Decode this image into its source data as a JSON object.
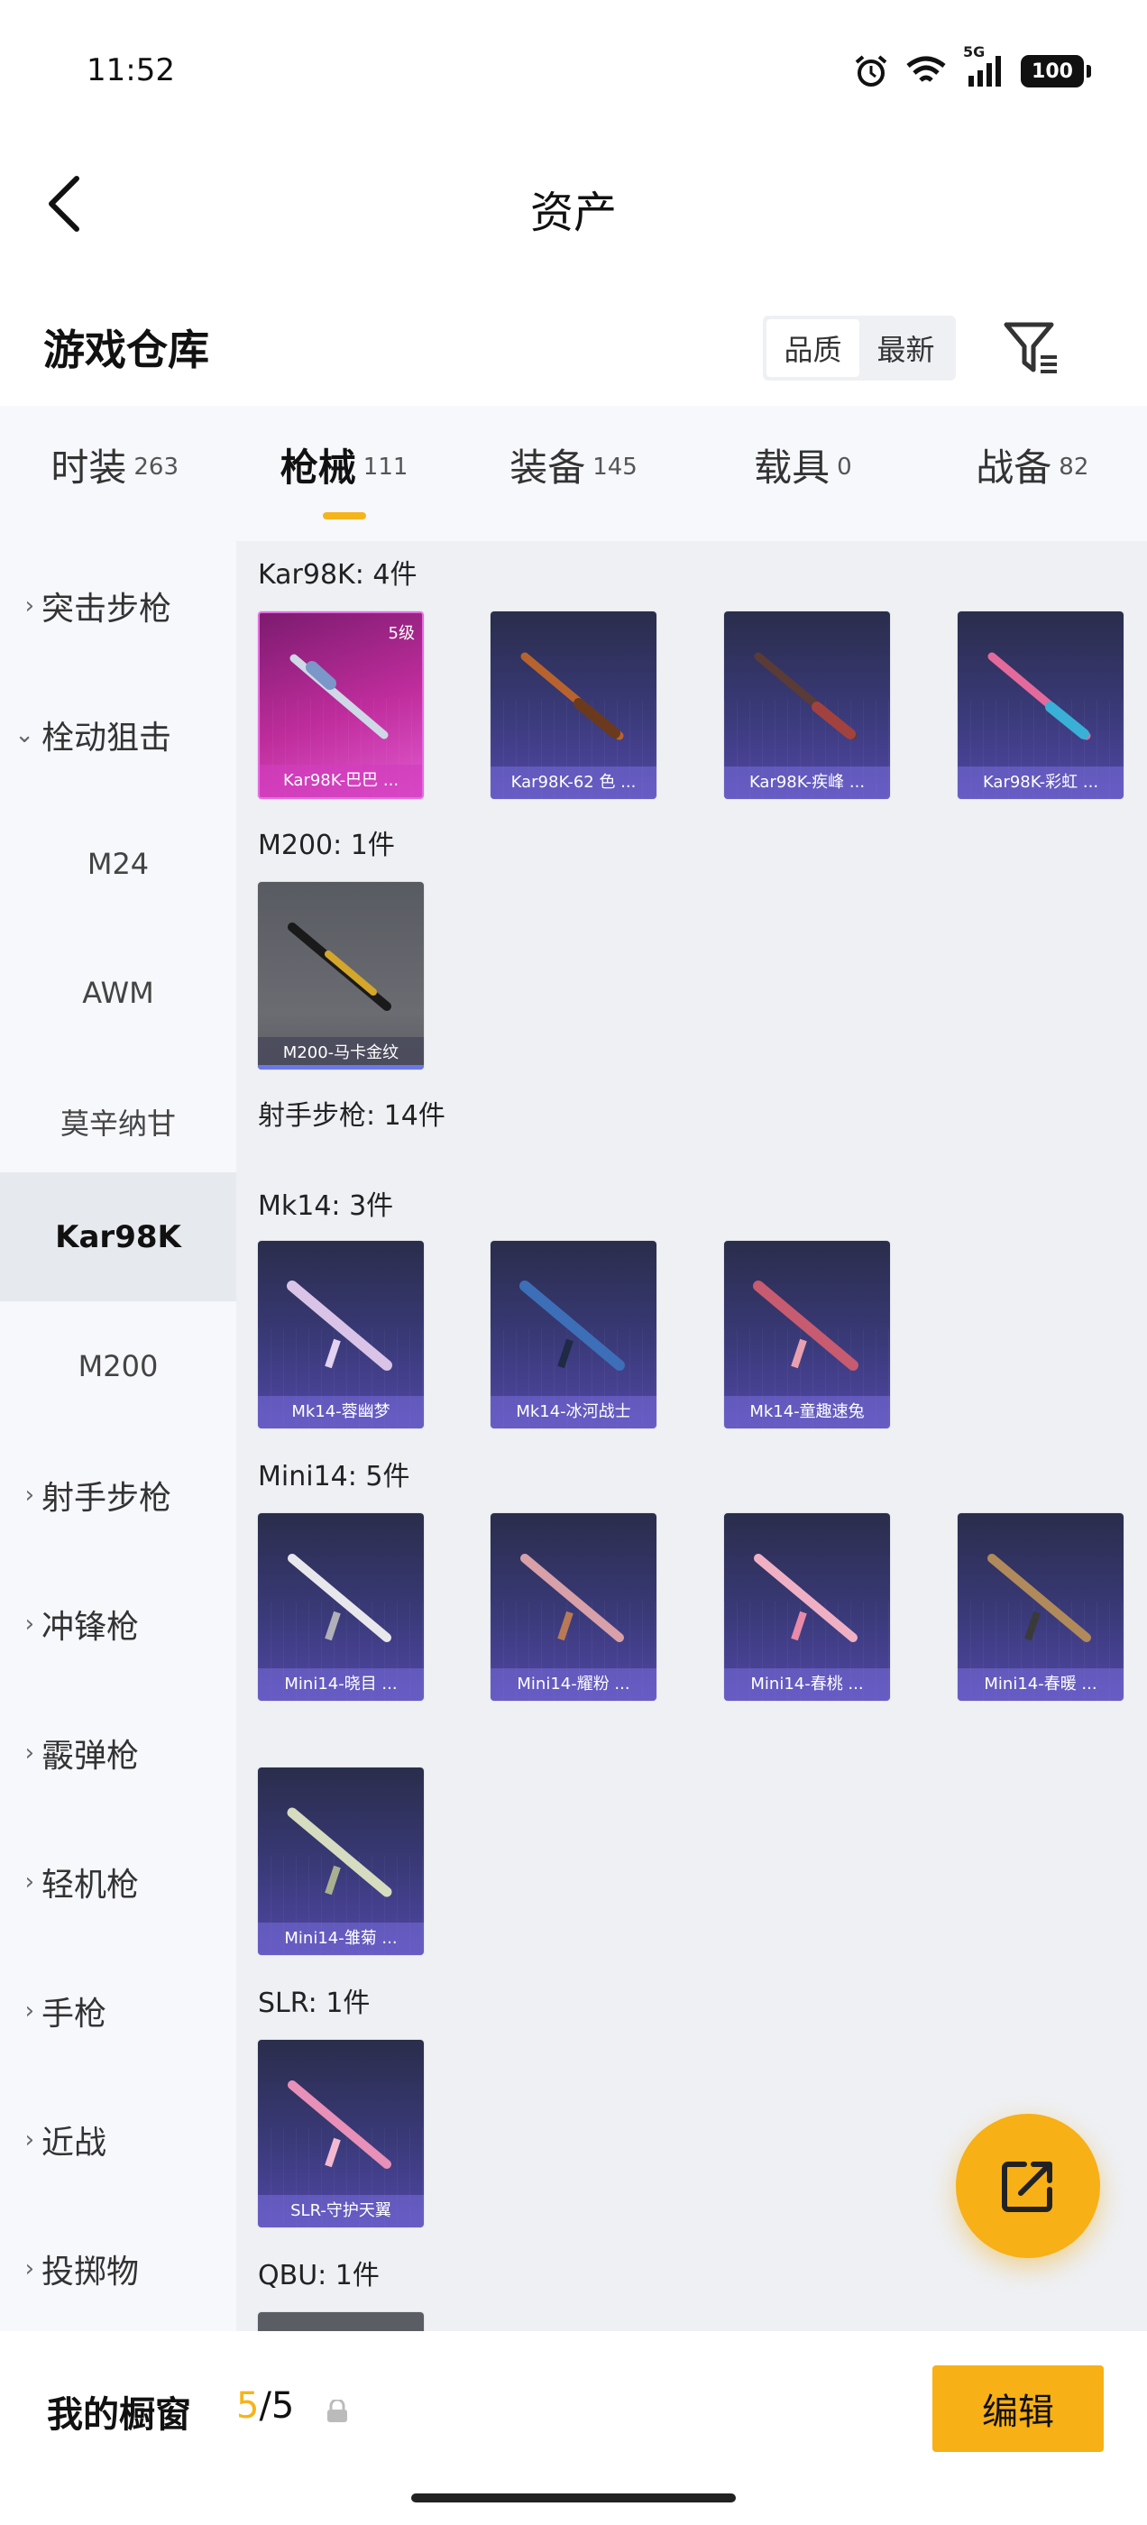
{
  "status_bar": {
    "time": "11:52",
    "network": "5G",
    "battery": "100"
  },
  "header": {
    "title": "资产"
  },
  "warehouse": {
    "title": "游戏仓库",
    "sort_options": [
      "品质",
      "最新"
    ]
  },
  "tabs": [
    {
      "label": "时装",
      "count": "263"
    },
    {
      "label": "枪械",
      "count": "111"
    },
    {
      "label": "装备",
      "count": "145"
    },
    {
      "label": "载具",
      "count": "0"
    },
    {
      "label": "战备",
      "count": "82"
    }
  ],
  "sidebar": {
    "items": [
      {
        "label": "突击步枪",
        "chevron": "›"
      },
      {
        "label": "栓动狙击",
        "chevron": "⌄"
      },
      {
        "label": "M24"
      },
      {
        "label": "AWM"
      },
      {
        "label": "莫辛纳甘"
      },
      {
        "label": "Kar98K"
      },
      {
        "label": "M200"
      },
      {
        "label": "射手步枪",
        "chevron": "›"
      },
      {
        "label": "冲锋枪",
        "chevron": "›"
      },
      {
        "label": "霰弹枪",
        "chevron": "›"
      },
      {
        "label": "轻机枪",
        "chevron": "›"
      },
      {
        "label": "手枪",
        "chevron": "›"
      },
      {
        "label": "近战",
        "chevron": "›"
      },
      {
        "label": "投掷物",
        "chevron": "›"
      }
    ]
  },
  "content": {
    "groups": [
      {
        "title": "Kar98K: 4件"
      },
      {
        "title": "M200: 1件"
      },
      {
        "title": "射手步枪: 14件"
      },
      {
        "title": "Mk14: 3件"
      },
      {
        "title": "Mini14: 5件"
      },
      {
        "title": "SLR: 1件"
      },
      {
        "title": "QBU: 1件"
      }
    ],
    "cards": [
      {
        "label": "Kar98K-巴巴 ...",
        "badge": "5级"
      },
      {
        "label": "Kar98K-62 色 ..."
      },
      {
        "label": "Kar98K-疾峰 ..."
      },
      {
        "label": "Kar98K-彩虹 ..."
      },
      {
        "label": "M200-马卡金纹"
      },
      {
        "label": "Mk14-蓉幽梦"
      },
      {
        "label": "Mk14-冰河战士"
      },
      {
        "label": "Mk14-童趣速兔"
      },
      {
        "label": "Mini14-晓目 ..."
      },
      {
        "label": "Mini14-耀粉 ..."
      },
      {
        "label": "Mini14-春桃 ..."
      },
      {
        "label": "Mini14-春暖 ..."
      },
      {
        "label": "Mini14-雏菊 ..."
      },
      {
        "label": "SLR-守护天翼"
      }
    ]
  },
  "bottom_bar": {
    "label": "我的橱窗",
    "count_current": "5",
    "count_total": "/5",
    "edit_label": "编辑"
  },
  "colors": {
    "accent": "#f7b015",
    "sidebar_bg": "#f6f8fc",
    "content_bg": "#eef0f4",
    "card_purple": "#3a3a7a",
    "card_pink": "#c02d9d"
  }
}
